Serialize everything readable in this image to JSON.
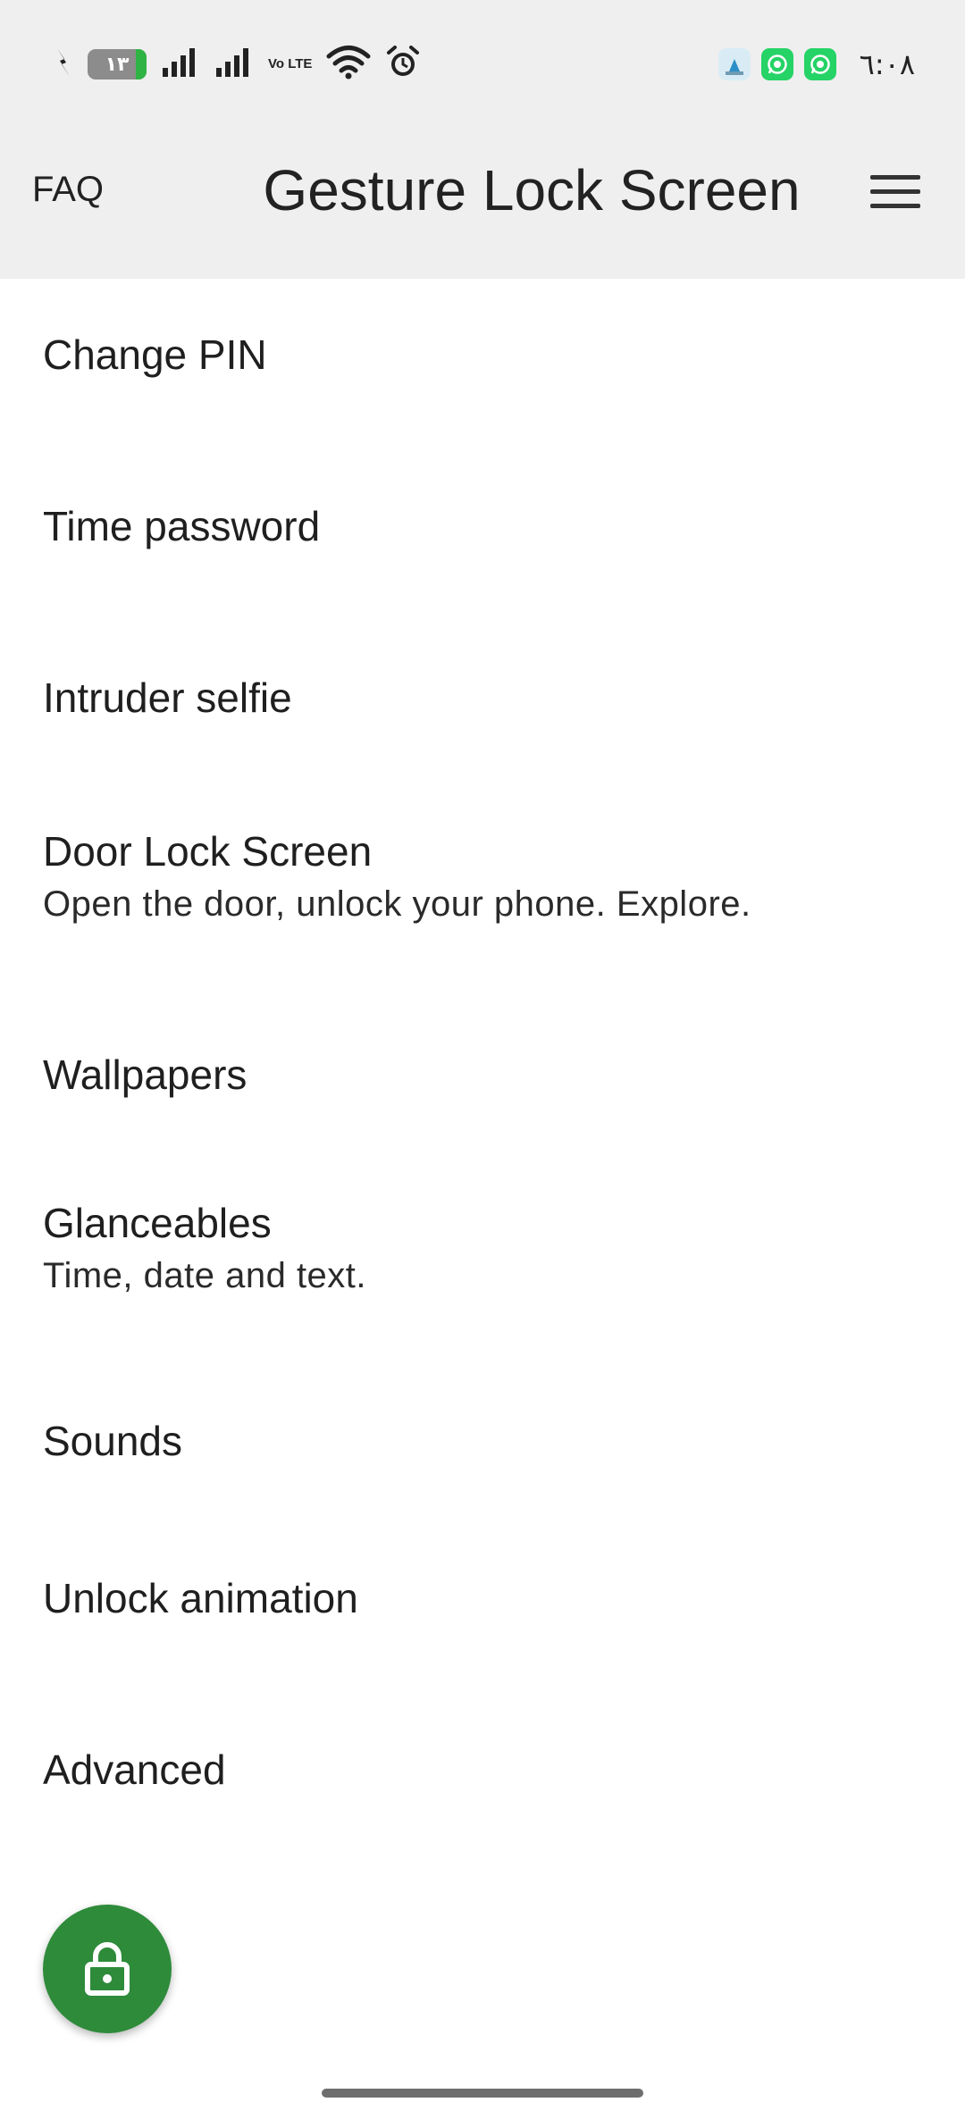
{
  "status_bar": {
    "battery_level_text": "١٣",
    "network_label": "Vo LTE",
    "time": "٦:٠٨",
    "icons": [
      "charging-bolt-icon",
      "signal-bars-icon",
      "signal-bars-icon",
      "volte-icon",
      "wifi-icon",
      "alarm-icon",
      "app-notification-icon",
      "whatsapp-icon",
      "whatsapp-business-icon"
    ],
    "colors": {
      "battery_fill": "#2fb344",
      "whatsapp": "#25d366"
    }
  },
  "app_bar": {
    "faq_label": "FAQ",
    "title": "Gesture Lock Screen",
    "menu_icon": "hamburger-menu-icon",
    "background": "#efefef"
  },
  "settings": {
    "items": [
      {
        "title": "Change PIN"
      },
      {
        "title": "Time password"
      },
      {
        "title": "Intruder selfie"
      },
      {
        "title": "Door Lock Screen",
        "subtitle": "Open the door, unlock your phone. Explore."
      },
      {
        "title": "Wallpapers"
      },
      {
        "title": "Glanceables",
        "subtitle": "Time, date and text."
      },
      {
        "title": "Sounds"
      },
      {
        "title": "Unlock animation"
      },
      {
        "title": "Advanced"
      }
    ]
  },
  "fab": {
    "icon": "lock-icon",
    "color": "#2e8b3a"
  }
}
